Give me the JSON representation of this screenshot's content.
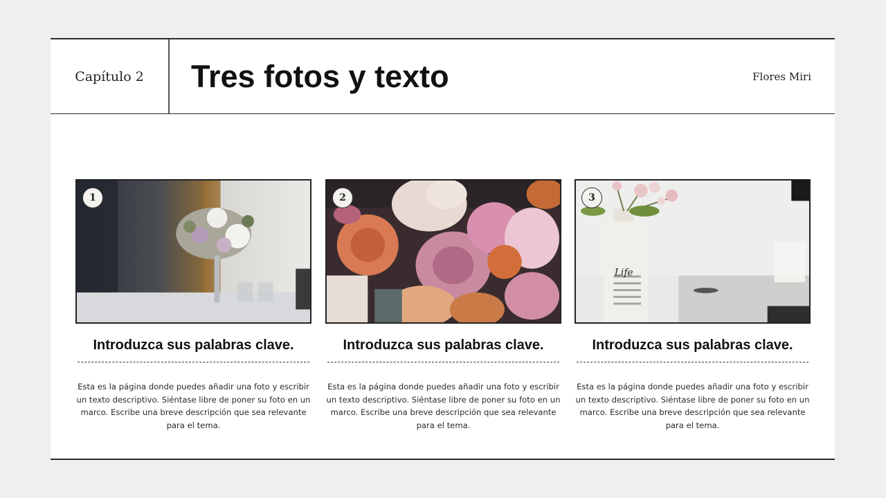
{
  "header": {
    "chapter": "Capítulo 2",
    "title": "Tres fotos y texto",
    "brand": "Flores Miri"
  },
  "cards": [
    {
      "number": "1",
      "photo": "flower-bouquet-on-table-photo",
      "heading": "Introduzca sus palabras clave.",
      "text": "Esta es la página donde puedes añadir una foto y escribir un texto descriptivo. Siéntase libre de poner su foto en un marco. Escribe una breve descripción que sea relevante para el tema."
    },
    {
      "number": "2",
      "photo": "peonies-and-roses-closeup-photo",
      "heading": "Introduzca sus palabras clave.",
      "text": "Esta es la página donde puedes añadir una foto y escribir un texto descriptivo. Siéntase libre de poner su foto en un marco. Escribe una breve descripción que sea relevante para el tema."
    },
    {
      "number": "3",
      "photo": "flowers-in-life-bottle-photo",
      "bottle_label": "Life",
      "heading": "Introduzca sus palabras clave.",
      "text": "Esta es la página donde puedes añadir una foto y escribir un texto descriptivo. Siéntase libre de poner su foto en un marco. Escribe una breve descripción que sea relevante para el tema."
    }
  ]
}
